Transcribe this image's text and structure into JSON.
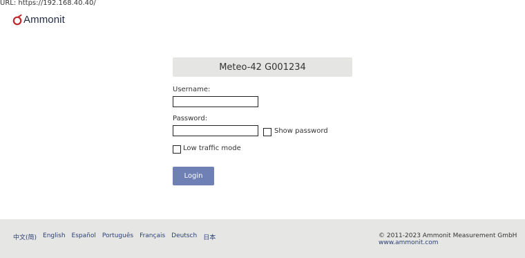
{
  "browser": {
    "url_text": "URL: https://192.168.40.40/"
  },
  "brand": {
    "name": "Ammonit",
    "logo_color": "#c0282d"
  },
  "device": {
    "name": "Meteo-42 G001234"
  },
  "login_form": {
    "username_label": "Username:",
    "username_value": "",
    "password_label": "Password:",
    "password_value": "",
    "show_password_label": "Show password",
    "show_password_checked": false,
    "low_traffic_label": "Low traffic mode",
    "low_traffic_checked": false,
    "login_button_label": "Login",
    "button_color": "#6e80b4"
  },
  "footer": {
    "languages": [
      "中文(简)",
      "English",
      "Español",
      "Português",
      "Français",
      "Deutsch",
      "日本"
    ],
    "copyright": "© 2011-2023 Ammonit Measurement GmbH",
    "website": "www.ammonit.com"
  }
}
